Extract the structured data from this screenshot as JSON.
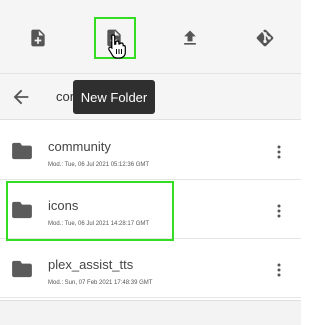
{
  "toolbar": {
    "buttons": [
      {
        "name": "new-file",
        "icon": "file-plus-icon"
      },
      {
        "name": "new-folder",
        "icon": "folder-plus-icon"
      },
      {
        "name": "upload",
        "icon": "upload-icon"
      },
      {
        "name": "git",
        "icon": "git-icon"
      }
    ]
  },
  "tooltip": {
    "text": "New Folder"
  },
  "path": {
    "visible_text": "cor"
  },
  "items": [
    {
      "name": "community",
      "modified": "Mod.: Tue, 06 Jul 2021 05:12:36 GMT"
    },
    {
      "name": "icons",
      "modified": "Mod.: Tue, 06 Jul 2021 14:28:17 GMT"
    },
    {
      "name": "plex_assist_tts",
      "modified": "Mod.: Sun, 07 Feb 2021 17:48:39 GMT"
    }
  ],
  "colors": {
    "highlight": "#33dd22",
    "toolbar_bg": "#f5f5f5",
    "tooltip_bg": "#2f2f2f",
    "icon": "#555555"
  }
}
